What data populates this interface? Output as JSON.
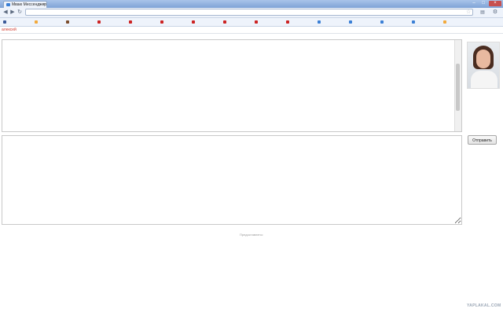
{
  "browser": {
    "tab_title": "Мваю Мессенджер",
    "url": "",
    "colors": {
      "accent": "#3a7fd5",
      "close": "#c75050"
    }
  },
  "bookmarks": [
    {
      "label": "",
      "color": "#3b5998"
    },
    {
      "label": "",
      "color": "#f2a93b"
    },
    {
      "label": "",
      "color": "#7a4b2a"
    },
    {
      "label": "",
      "color": "#cc2222"
    },
    {
      "label": "",
      "color": "#cc2222"
    },
    {
      "label": "",
      "color": "#cc2222"
    },
    {
      "label": "",
      "color": "#cc2222"
    },
    {
      "label": "",
      "color": "#cc2222"
    },
    {
      "label": "",
      "color": "#cc2222"
    },
    {
      "label": "",
      "color": "#cc2222"
    },
    {
      "label": "",
      "color": "#3a7fd5"
    },
    {
      "label": "",
      "color": "#3a7fd5"
    },
    {
      "label": "",
      "color": "#3a7fd5"
    },
    {
      "label": "",
      "color": "#3a7fd5"
    },
    {
      "label": "",
      "color": "#f2a93b"
    }
  ],
  "page": {
    "user_name": "алексей",
    "send_label": "Отправить",
    "footer_prefix": "Предоставлено:",
    "footer_link": "",
    "colors": {
      "user_name": "#d0382b",
      "link": "#7d9fc7"
    }
  },
  "chat": [],
  "watermark": "YAPLAKAL.COM"
}
